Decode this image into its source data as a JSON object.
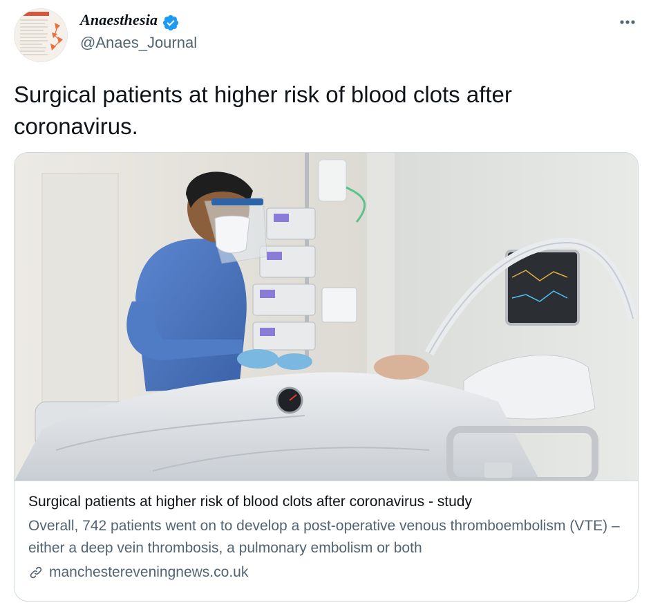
{
  "author": {
    "name": "Anaesthesia",
    "handle": "@Anaes_Journal",
    "verified": true,
    "avatar_icon": "journal-cover-avatar"
  },
  "tweet": {
    "text": "Surgical patients at higher risk of blood clots after coronavirus."
  },
  "card": {
    "title": "Surgical patients at higher risk of blood clots after coronavirus - study",
    "description": "Overall, 742 patients went on to develop a post-operative venous thromboembolism (VTE) – either a deep vein thrombosis, a pulmonary embolism or both",
    "domain": "manchestereveningnews.co.uk",
    "image_icon": "icu-nurse-photo"
  },
  "colors": {
    "verified_badge": "#1d9bf0",
    "secondary_text": "#536471",
    "border": "#cfd9de",
    "gown_blue": "#4a78c4"
  }
}
